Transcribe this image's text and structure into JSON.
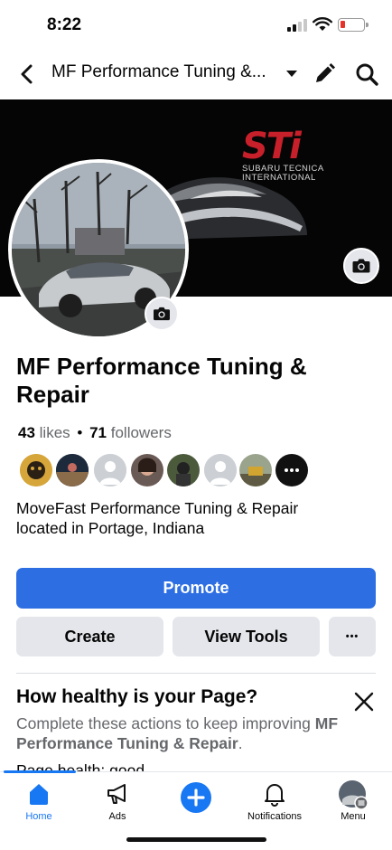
{
  "status_bar": {
    "time": "8:22"
  },
  "nav": {
    "title": "MF Performance Tuning &..."
  },
  "cover": {
    "brand_mark": "STi",
    "brand_line1": "SUBARU TECNICA",
    "brand_line2": "INTERNATIONAL"
  },
  "page": {
    "name": "MF Performance Tuning & Repair",
    "likes_count": "43",
    "likes_label": "likes",
    "separator": "•",
    "followers_count": "71",
    "followers_label": "followers",
    "about": "MoveFast Performance Tuning & Repair located in Portage, Indiana"
  },
  "actions": {
    "promote": "Promote",
    "create": "Create",
    "view_tools": "View Tools",
    "more": "•••"
  },
  "health": {
    "title": "How healthy is your Page?",
    "desc_prefix": "Complete these actions to keep improving",
    "desc_name": "MF Performance Tuning & Repair",
    "desc_suffix": ".",
    "status": "Page health: good"
  },
  "tabs": [
    {
      "label": "Home",
      "icon": "home-icon",
      "active": true
    },
    {
      "label": "Ads",
      "icon": "megaphone-icon"
    },
    {
      "label": "",
      "icon": "plus-icon"
    },
    {
      "label": "Notifications",
      "icon": "bell-icon"
    },
    {
      "label": "Menu",
      "icon": "profile-menu-icon"
    }
  ],
  "colors": {
    "accent": "#1877f2",
    "promote": "#2d6ee2",
    "secondary_button": "#e4e6eb",
    "sti_red": "#c8202a",
    "battery_low": "#e5332a"
  }
}
